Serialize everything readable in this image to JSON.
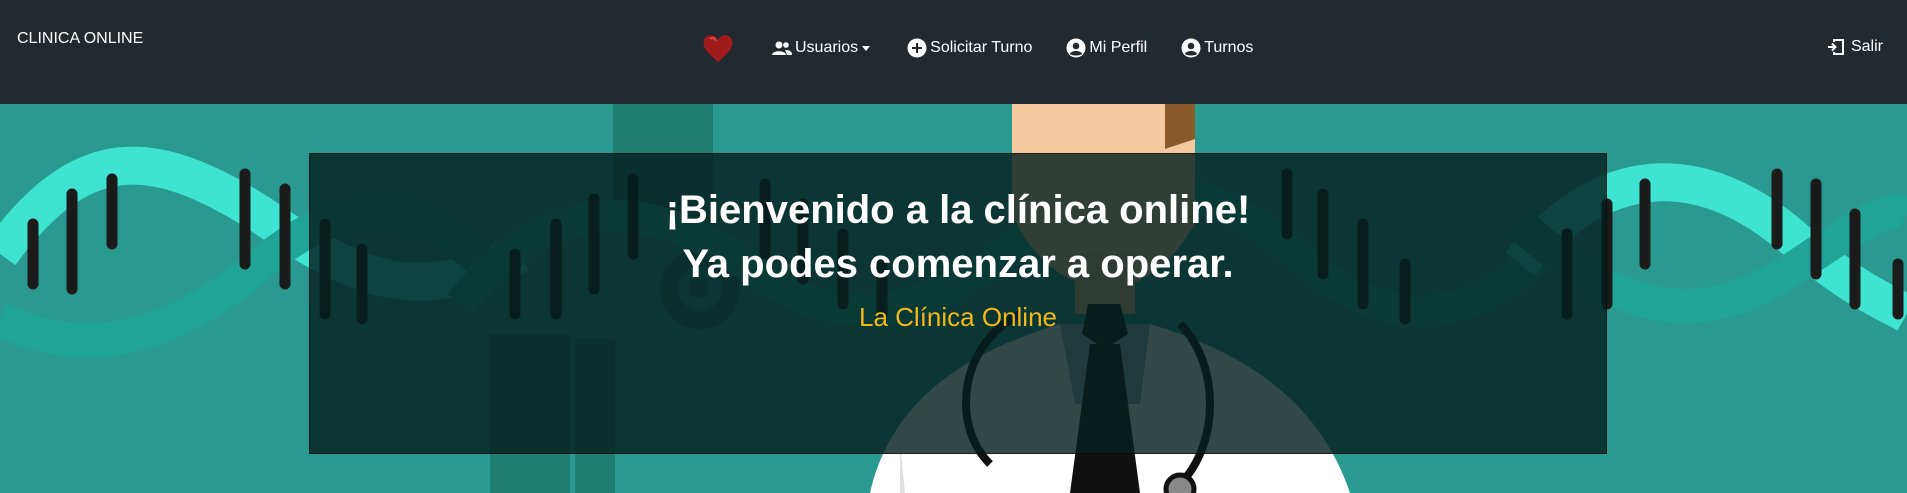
{
  "navbar": {
    "brand": "CLINICA ONLINE",
    "logo_icon": "heart-icon",
    "items": [
      {
        "label": "Usuarios",
        "icon": "users-icon",
        "dropdown": true
      },
      {
        "label": "Solicitar Turno",
        "icon": "plus-circle-icon"
      },
      {
        "label": "Mi Perfil",
        "icon": "user-circle-icon"
      },
      {
        "label": "Turnos",
        "icon": "user-circle-icon"
      }
    ],
    "logout": {
      "label": "Salir",
      "icon": "logout-icon"
    }
  },
  "hero": {
    "title_line1": "¡Bienvenido a la clínica online!",
    "title_line2": "Ya podes comenzar a operar.",
    "subtitle": "La Clínica Online"
  },
  "colors": {
    "navbar_bg": "#222a30",
    "hero_bg": "#2a9a90",
    "subtitle": "#f0b81a"
  }
}
